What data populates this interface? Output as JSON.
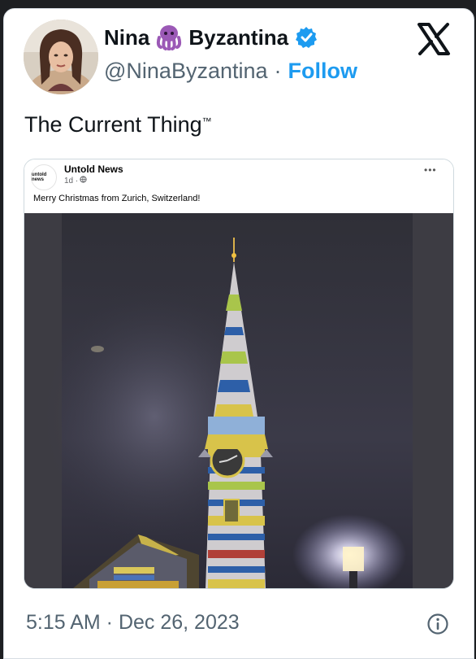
{
  "author": {
    "name_first": "Nina",
    "name_last": "Byzantina",
    "handle": "@NinaByzantina",
    "separator": "·",
    "follow_label": "Follow"
  },
  "tweet": {
    "text": "The Current Thing",
    "tm": "™",
    "timestamp": "5:15 AM · Dec 26, 2023"
  },
  "embed": {
    "page_name": "Untold News",
    "logo_text": "untold news",
    "age": "1d ·",
    "more": "•••",
    "post_text": "Merry Christmas from Zurich, Switzerland!"
  },
  "colors": {
    "link": "#1d9bf0",
    "verified": "#1d9bf0",
    "octopus": "#9b59b6"
  }
}
